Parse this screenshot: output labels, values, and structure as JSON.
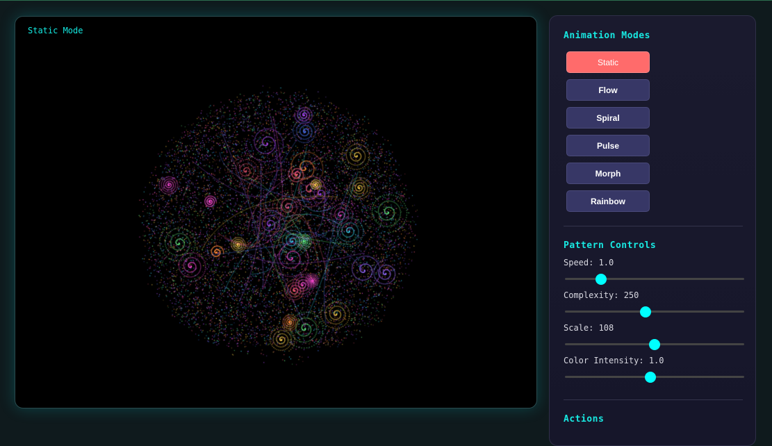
{
  "canvas": {
    "mode_label": "Static Mode"
  },
  "animation_modes": {
    "title": "Animation Modes",
    "active": "Static",
    "buttons": [
      "Static",
      "Flow",
      "Spiral",
      "Pulse",
      "Morph",
      "Rainbow"
    ]
  },
  "pattern_controls": {
    "title": "Pattern Controls",
    "sliders": [
      {
        "label": "Speed: 1.0",
        "fraction": 0.2
      },
      {
        "label": "Complexity: 250",
        "fraction": 0.45
      },
      {
        "label": "Scale: 108",
        "fraction": 0.5
      },
      {
        "label": "Color Intensity: 1.0",
        "fraction": 0.475
      }
    ]
  },
  "actions": {
    "title": "Actions"
  },
  "colors": {
    "accent": "#00ffff",
    "active_button": "#ff6b6b",
    "button": "#373766",
    "title": "#18e9e2"
  }
}
